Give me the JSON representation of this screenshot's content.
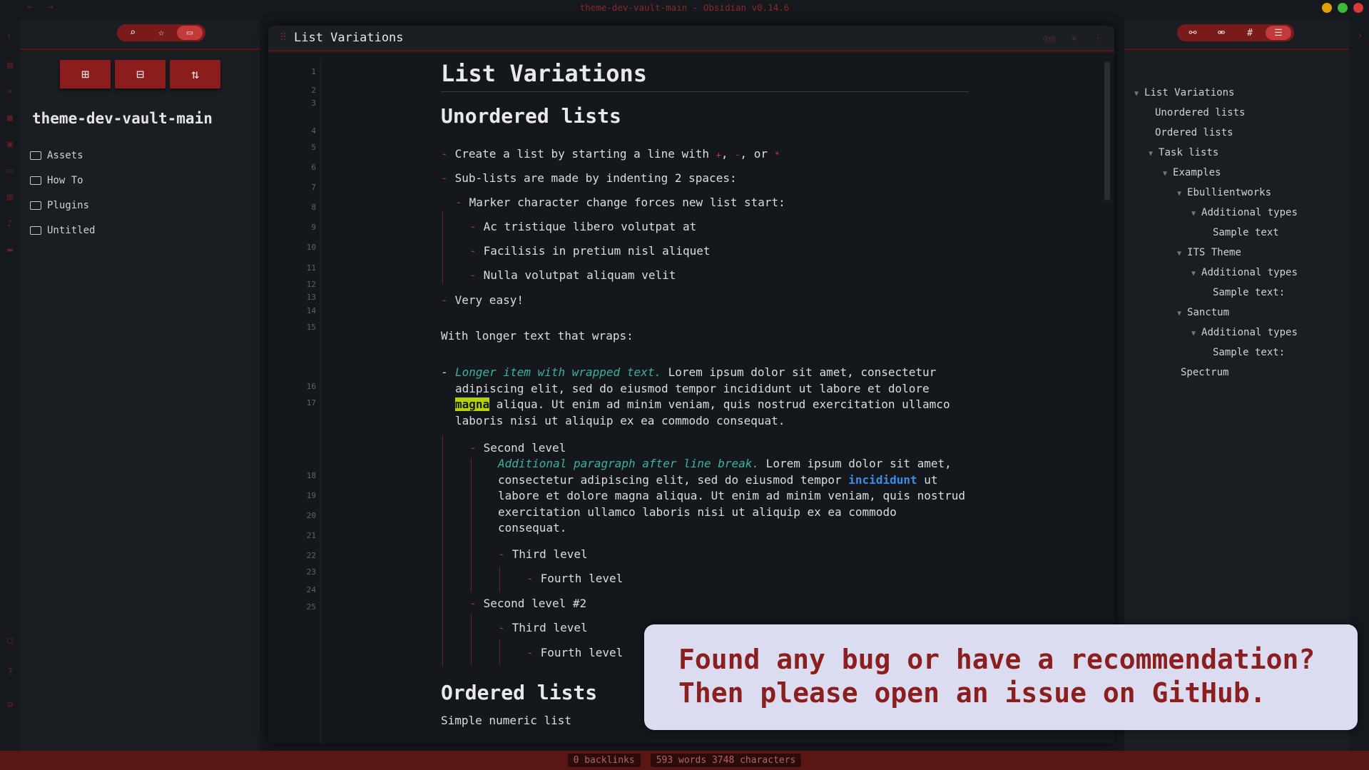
{
  "window": {
    "title": "theme-dev-vault-main - Obsidian v0.14.6",
    "traffic_colors": [
      "#e0a000",
      "#3cba3c",
      "#d63a3a"
    ]
  },
  "left_sidebar": {
    "tabs": [
      "search-icon",
      "star-icon",
      "folder-icon"
    ],
    "actions": [
      "new-note-icon",
      "new-folder-icon",
      "sort-icon"
    ],
    "vault_name": "theme-dev-vault-main",
    "folders": [
      "Assets",
      "How To",
      "Plugins",
      "Untitled"
    ]
  },
  "editor": {
    "tab_title": "List Variations",
    "line_numbers": [
      "1",
      "2",
      "3",
      "4",
      "5",
      "6",
      "7",
      "8",
      "9",
      "10",
      "11",
      "12",
      "13",
      "14",
      "15",
      "16",
      "17",
      "18",
      "19",
      "20",
      "21",
      "22",
      "23",
      "24",
      "25"
    ],
    "h1": "List Variations",
    "h2_unordered": "Unordered lists",
    "h2_ordered": "Ordered lists",
    "l5_pre": "Create a list by starting a line with ",
    "l5_m1": "+",
    "l5_sep1": ", ",
    "l5_m2": "-",
    "l5_sep2": ", or ",
    "l5_m3": "*",
    "l6": "Sub-lists are made by indenting 2 spaces:",
    "l7": "Marker character change forces new list start:",
    "l8": "Ac tristique libero volutpat at",
    "l9": "Facilisis in pretium nisl aliquet",
    "l10": "Nulla volutpat aliquam velit",
    "l11": "Very easy!",
    "l13": "With longer text that wraps:",
    "l15_em": "Longer item with wrapped text.",
    "l15_a": " Lorem ipsum dolor sit amet, consectetur adipiscing elit, sed do eiusmod tempor incididunt ut labore et dolore ",
    "l15_hl": "magna",
    "l15_b": " aliqua. Ut enim ad minim veniam, quis nostrud exercitation ullamco laboris nisi ut aliquip ex ea commodo consequat.",
    "l16": "Second level",
    "l17_em": "Additional paragraph after line break.",
    "l17_a": " Lorem ipsum dolor sit amet, consectetur adipiscing elit, sed do eiusmod tempor ",
    "l17_link": "incididunt",
    "l17_b": " ut labore et dolore magna aliqua. Ut enim ad minim veniam, quis nostrud exercitation ullamco laboris nisi ut aliquip ex ea commodo consequat.",
    "l18": "Third level",
    "l19": "Fourth level",
    "l20": "Second level #2",
    "l21": "Third level",
    "l22": "Fourth level",
    "l25": "Simple numeric list",
    "bullet": "-"
  },
  "outline": [
    {
      "label": "List Variations",
      "collapse": true
    },
    {
      "label": "Unordered lists",
      "collapse": false
    },
    {
      "label": "Ordered lists",
      "collapse": false
    },
    {
      "label": "Task lists",
      "collapse": true
    },
    {
      "label": "Examples",
      "collapse": true
    },
    {
      "label": "Ebullientworks",
      "collapse": true
    },
    {
      "label": "Additional types",
      "collapse": true
    },
    {
      "label": "Sample text",
      "collapse": false
    },
    {
      "label": "ITS Theme",
      "collapse": true
    },
    {
      "label": "Additional types",
      "collapse": true
    },
    {
      "label": "Sample text:",
      "collapse": false
    },
    {
      "label": "Sanctum",
      "collapse": true
    },
    {
      "label": "Additional types",
      "collapse": true
    },
    {
      "label": "Sample text:",
      "collapse": false
    },
    {
      "label": "Spectrum",
      "collapse": false
    }
  ],
  "right_sidebar": {
    "tabs": [
      "backlinks-icon",
      "outgoing-links-icon",
      "tag-icon",
      "outline-icon"
    ]
  },
  "status": {
    "backlinks": "0 backlinks",
    "counts": "593 words 3748 characters"
  },
  "banner": {
    "line1": "Found any bug or have a recommendation?",
    "line2": "Then please open an issue on GitHub."
  }
}
